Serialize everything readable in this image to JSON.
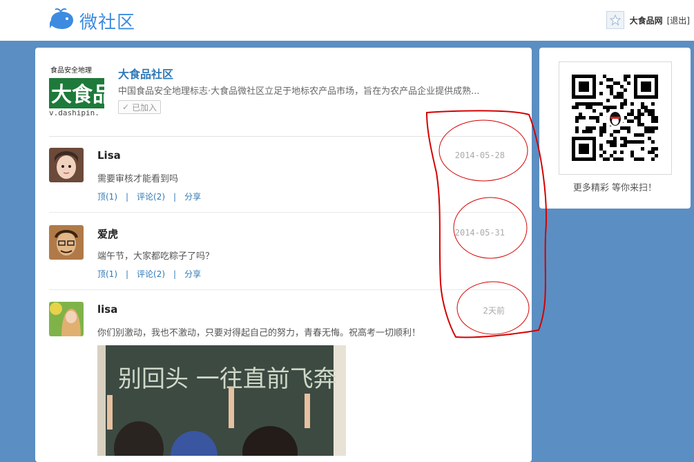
{
  "header": {
    "logo_text": "微社区",
    "user_name": "大食品网",
    "logout_label": "[退出]"
  },
  "community": {
    "name": "大食品社区",
    "description": "中国食品安全地理标志·大食品微社区立足于地标农产品市场，旨在为农产品企业提供成熟...",
    "joined_label": "已加入",
    "logo_top_text": "食品安全地理",
    "logo_big_text": "大食品",
    "logo_url_text": "v.dashipin."
  },
  "posts": [
    {
      "user": "Lisa",
      "date": "2014-05-28",
      "content": "需要审核才能看到吗",
      "like_label": "顶(1)",
      "comment_label": "评论(2)",
      "share_label": "分享"
    },
    {
      "user": "爱虎",
      "date": "2014-05-31",
      "content": "端午节，大家都吃粽子了吗？",
      "like_label": "顶(1)",
      "comment_label": "评论(2)",
      "share_label": "分享"
    },
    {
      "user": "lisa",
      "date": "2天前",
      "content": "你们别激动，我也不激动，只要对得起自己的努力，青春无悔。祝高考一切顺利！",
      "image_text": "别回头 一往直前飞奔"
    }
  ],
  "sidebar": {
    "qr_caption": "更多精彩 等你来扫！"
  },
  "colors": {
    "page_bg": "#5b8ec2",
    "brand_blue": "#3d8be0",
    "link_blue": "#2f79b8",
    "annotation_red": "#d40000"
  }
}
